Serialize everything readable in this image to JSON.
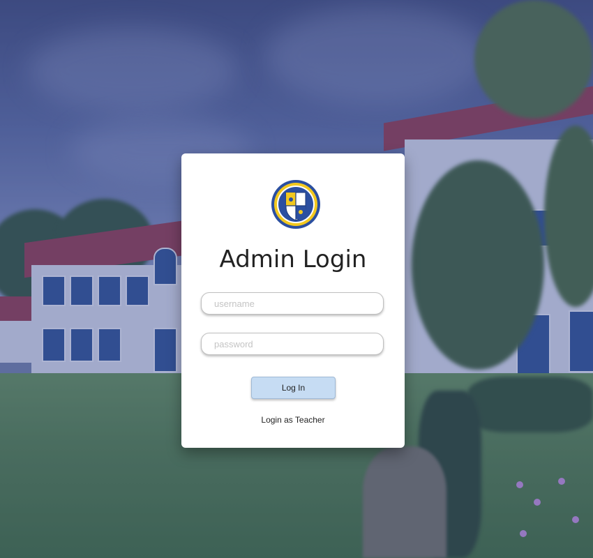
{
  "login": {
    "title": "Admin Login",
    "username_placeholder": "username",
    "password_placeholder": "password",
    "login_button": "Log In",
    "teacher_link": "Login as Teacher"
  },
  "colors": {
    "card_background": "#ffffff",
    "button_background": "#c6dcf3",
    "overlay": "#3c4b96",
    "seal_blue": "#2b4fa0",
    "seal_gold": "#f2c81f"
  },
  "icons": {
    "seal": "school-seal-icon"
  }
}
